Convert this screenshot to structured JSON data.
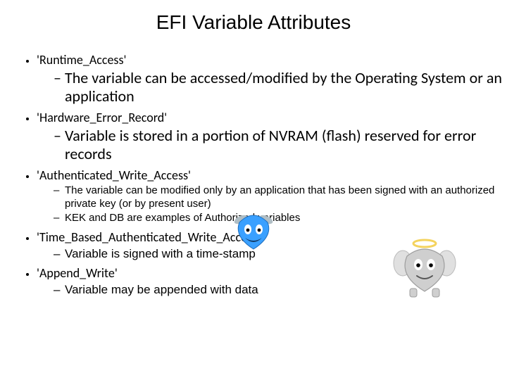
{
  "title": "EFI Variable Attributes",
  "bullets": {
    "b1": {
      "label": "'Runtime_Access'",
      "sub1": "The variable can be accessed/modified by the Operating System or an application"
    },
    "b2": {
      "label": "'Hardware_Error_Record'",
      "sub1": "Variable is stored in a portion of NVRAM (flash) reserved for error records"
    },
    "b3": {
      "label": "'Authenticated_Write_Access'",
      "sub1": "The variable can be modified only by an application that has been signed with an authorized private key (or by present user)",
      "sub2": "KEK and DB are examples of Authorized variables"
    },
    "b4": {
      "label": "'Time_Based_Authenticated_Write_Access'",
      "sub1": "Variable is signed with a time-stamp"
    },
    "b5": {
      "label": "'Append_Write'",
      "sub1": "Variable may be appended with data"
    }
  }
}
